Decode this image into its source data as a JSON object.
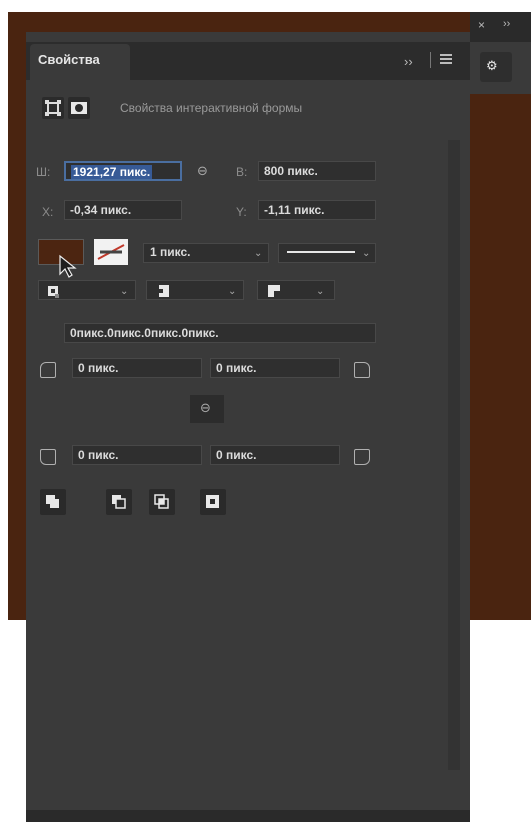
{
  "panel": {
    "tab_label": "Свойства",
    "collapse_glyph": "››",
    "dock_close": "×",
    "dock_expand": "››",
    "dock_icon_glyph": "⚙",
    "section_title": "Свойства интерактивной формы"
  },
  "transform": {
    "w_label": "Ш:",
    "w_value": "1921,27 пикс.",
    "h_label": "В:",
    "h_value": "800 пикс.",
    "x_label": "X:",
    "x_value": "-0,34 пикс.",
    "y_label": "Y:",
    "y_value": "-1,11 пикс.",
    "link_glyph": "⊖"
  },
  "appearance": {
    "fill_color": "#4c2511",
    "stroke_width": "1 пикс.",
    "stroke_type": "solid"
  },
  "corners": {
    "combined": "0пикс.0пикс.0пикс.0пикс.",
    "top_left": "0 пикс.",
    "top_right": "0 пикс.",
    "bottom_left": "0 пикс.",
    "bottom_right": "0 пикс.",
    "link_glyph": "⊖"
  },
  "path_operations": [
    "combine-shapes-icon",
    "subtract-front-shape-icon",
    "intersect-shape-areas-icon",
    "exclude-overlapping-shapes-icon"
  ],
  "colors": {
    "background": "#4a2410",
    "panel": "#3a3a3a",
    "selection": "#375a96"
  }
}
